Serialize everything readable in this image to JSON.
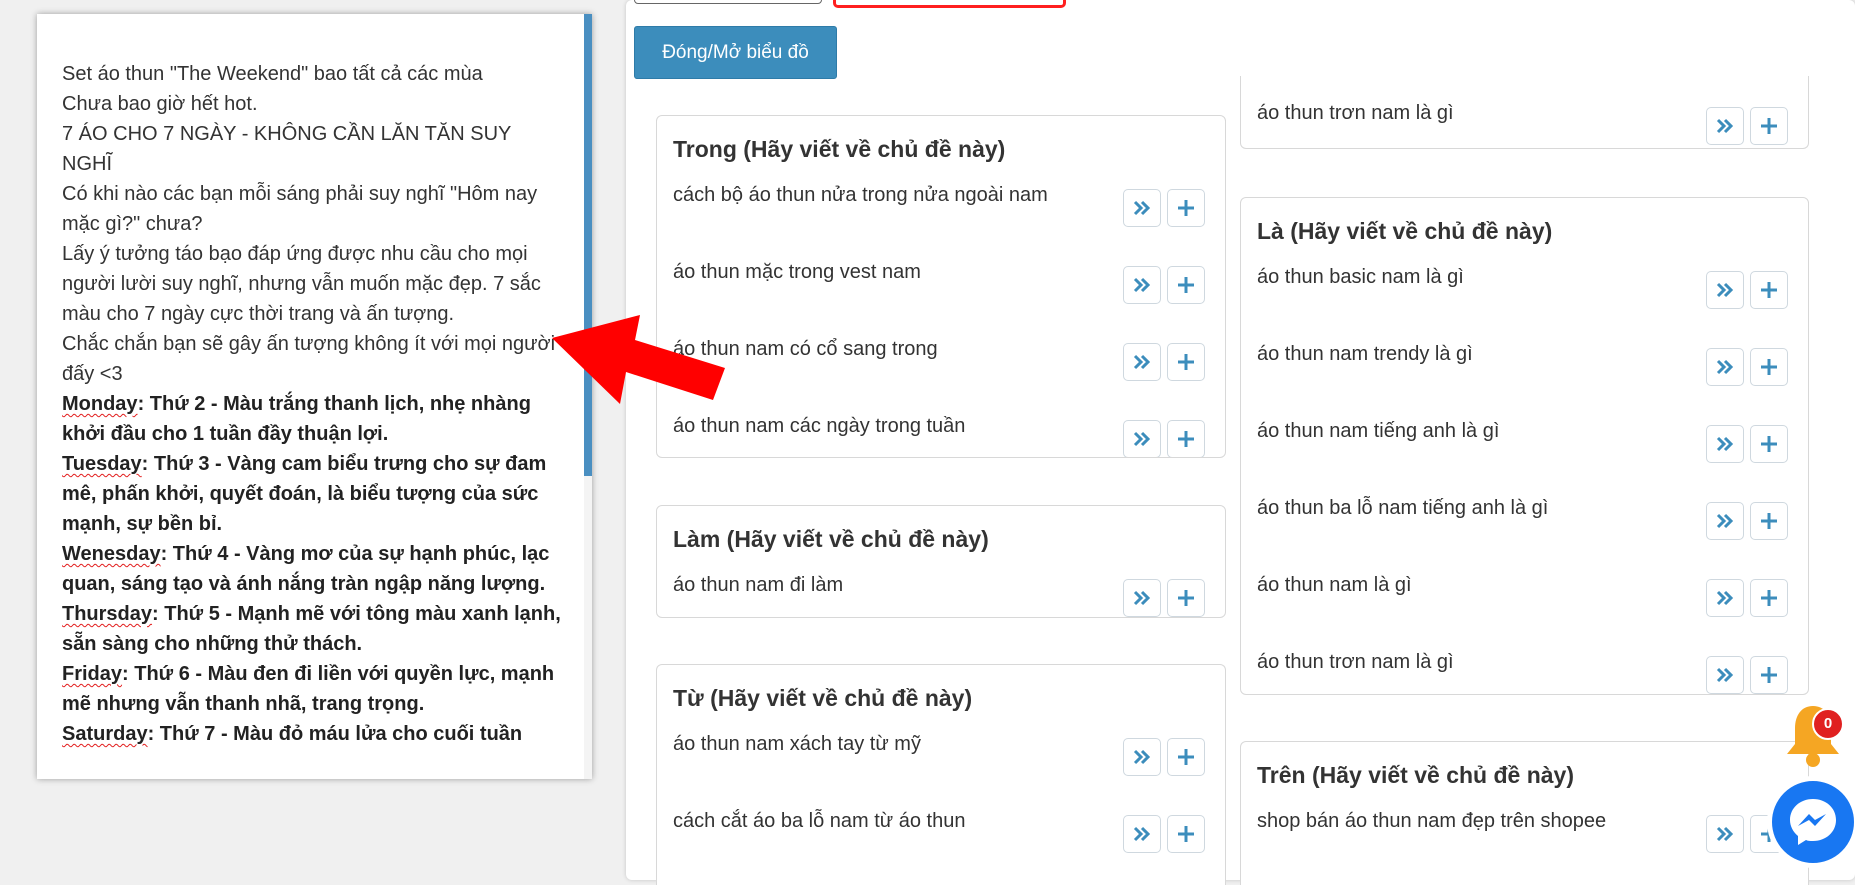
{
  "toolbar": {
    "toggle_chart_label": "Đóng/Mở biểu đồ"
  },
  "colors": {
    "primary": "#3c8dbc",
    "arrow": "#ff0000",
    "badge": "#e02020",
    "messenger": "#1877f2"
  },
  "icons": {
    "forward": "double-chevron-right-icon",
    "add": "plus-icon",
    "bell": "bell-icon",
    "messenger": "messenger-icon"
  },
  "groups": {
    "partial_top": {
      "items": [
        {
          "text": "áo thun trơn nam là gì"
        }
      ]
    },
    "trong": {
      "title": "Trong (Hãy viết về chủ đề này)",
      "items": [
        {
          "text": "cách bộ áo thun nửa trong nửa ngoài nam"
        },
        {
          "text": "áo thun mặc trong vest nam"
        },
        {
          "text": "áo thun nam có cổ sang trong"
        },
        {
          "text": "áo thun nam các ngày trong tuần"
        }
      ]
    },
    "la": {
      "title": "Là (Hãy viết về chủ đề này)",
      "items": [
        {
          "text": "áo thun basic nam là gì"
        },
        {
          "text": "áo thun nam trendy là gì"
        },
        {
          "text": "áo thun nam tiếng anh là gì"
        },
        {
          "text": "áo thun ba lỗ nam tiếng anh là gì"
        },
        {
          "text": "áo thun nam là gì"
        },
        {
          "text": "áo thun trơn nam là gì"
        }
      ]
    },
    "lam": {
      "title": "Làm (Hãy viết về chủ đề này)",
      "items": [
        {
          "text": "áo thun nam đi làm"
        }
      ]
    },
    "tu": {
      "title": "Từ (Hãy viết về chủ đề này)",
      "items": [
        {
          "text": "áo thun nam xách tay từ mỹ"
        },
        {
          "text": "cách cắt áo ba lỗ nam từ áo thun"
        }
      ]
    },
    "tren": {
      "title": "Trên (Hãy viết về chủ đề này)",
      "items": [
        {
          "text": "shop bán áo thun nam đẹp trên shopee"
        }
      ]
    }
  },
  "editor": {
    "p1": "Set áo thun \"The Weekend\" bao tất cả các mùa",
    "p2": "Chưa bao giờ hết hot.",
    "p3": "7 ÁO CHO 7 NGÀY - KHÔNG CẦN LĂN TĂN SUY NGHĨ",
    "p4": "Có khi nào các bạn mỗi sáng phải suy nghĩ \"Hôm nay mặc gì?\" chưa?",
    "p5": "Lấy ý tưởng táo bạo đáp ứng được nhu cầu cho mọi người lười suy nghĩ, nhưng  vẫn muốn mặc đẹp. 7 sắc màu cho 7 ngày cực thời trang và ấn tượng.",
    "p6": "Chắc chắn bạn sẽ gây ấn tượng không ít với mọi người đấy <3",
    "days": [
      {
        "day": "Monday",
        "desc": ": Thứ 2 -  Màu trắng thanh lịch, nhẹ nhàng khởi đầu cho 1 tuần đầy thuận lợi."
      },
      {
        "day": "Tuesday",
        "desc": ": Thứ 3 - Vàng cam biểu trưng cho sự đam mê, phấn khởi, quyết đoán, là biểu tượng của sức mạnh, sự bền bỉ."
      },
      {
        "day": "Wenesday",
        "desc": ": Thứ 4 - Vàng mơ của sự hạnh phúc, lạc quan, sáng tạo và ánh nắng tràn ngập năng lượng."
      },
      {
        "day": "Thursday",
        "desc": ": Thứ 5 - Mạnh mẽ với tông màu xanh lạnh, sẵn sàng cho những thử thách."
      },
      {
        "day": "Friday",
        "desc": ": Thứ 6 - Màu đen đi liền với quyền lực, mạnh mẽ nhưng vẫn thanh nhã, trang trọng."
      },
      {
        "day": "Saturday",
        "desc": ": Thứ 7 - Màu đỏ máu lửa cho cuối tuần"
      }
    ]
  },
  "notifications": {
    "count": "0"
  }
}
